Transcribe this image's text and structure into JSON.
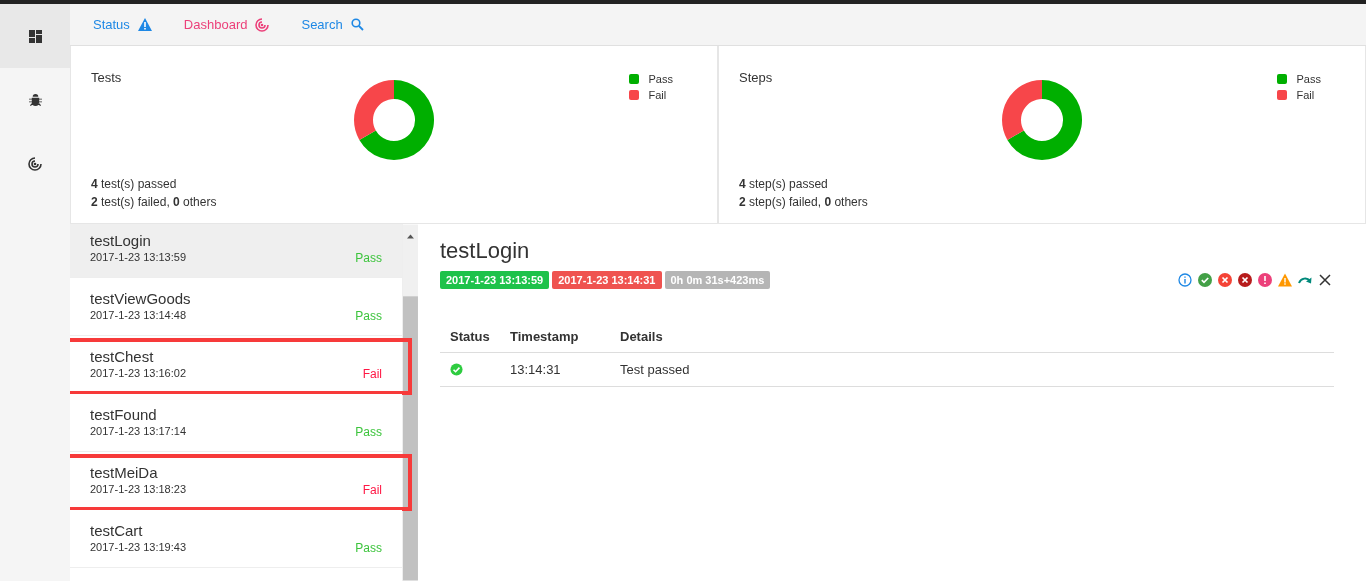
{
  "sidebar": {
    "items": [
      {
        "selected": true
      },
      {
        "selected": false
      },
      {
        "selected": false
      }
    ]
  },
  "nav": {
    "items": [
      {
        "label": "Status",
        "color": "#1e88e5"
      },
      {
        "label": "Dashboard",
        "color": "#ec407a"
      },
      {
        "label": "Search",
        "color": "#1e88e5"
      }
    ]
  },
  "dashboard": {
    "cards": [
      {
        "title": "Tests",
        "legend": [
          {
            "color": "#00af00"
          },
          {
            "color": "#f7464a"
          }
        ],
        "chart_data": {
          "type": "donut",
          "categories": [
            "Pass",
            "Fail"
          ],
          "values": [
            66.67,
            33.33
          ]
        },
        "summary": [
          "**4** test(s) passed",
          "**2** test(s) failed, **0** others"
        ]
      },
      {
        "title": "Steps",
        "legend": [
          {
            "color": "#00af00"
          },
          {
            "color": "#f7464a"
          }
        ],
        "chart_data": {
          "type": "donut",
          "categories": [
            "Pass",
            "Fail"
          ],
          "values": [
            66.67,
            33.33
          ]
        },
        "summary": [
          "**4** step(s) passed",
          "**2** step(s) failed, **0** others"
        ]
      }
    ]
  },
  "tests": {
    "items": [
      {
        "name": "testLogin",
        "time": "2017-1-23 13:13:59",
        "status": "Pass",
        "color": "#3cc43c",
        "selected": true,
        "highlighted": false
      },
      {
        "name": "testViewGoods",
        "time": "2017-1-23 13:14:48",
        "status": "Pass",
        "color": "#3cc43c",
        "selected": false,
        "highlighted": false
      },
      {
        "name": "testChest",
        "time": "2017-1-23 13:16:02",
        "status": "Fail",
        "color": "#ff1744",
        "selected": false,
        "highlighted": true
      },
      {
        "name": "testFound",
        "time": "2017-1-23 13:17:14",
        "status": "Pass",
        "color": "#3cc43c",
        "selected": false,
        "highlighted": false
      },
      {
        "name": "testMeiDa",
        "time": "2017-1-23 13:18:23",
        "status": "Fail",
        "color": "#ff1744",
        "selected": false,
        "highlighted": true
      },
      {
        "name": "testCart",
        "time": "2017-1-23 13:19:43",
        "status": "Pass",
        "color": "#3cc43c",
        "selected": false,
        "highlighted": false
      }
    ]
  },
  "detail": {
    "title": "testLogin",
    "badges": [
      {
        "text": "2017-1-23 13:13:59",
        "color": "#1ec24a"
      },
      {
        "text": "2017-1-23 13:14:31",
        "color": "#ef5350"
      },
      {
        "text": "0h 0m 31s+423ms",
        "color": "#b5b5b5"
      }
    ],
    "log": {
      "columns": [
        "Status",
        "Timestamp",
        "Details"
      ],
      "rows": [
        {
          "kind": "pass",
          "timestamp": "13:14:31",
          "details": "Test passed"
        }
      ]
    }
  }
}
